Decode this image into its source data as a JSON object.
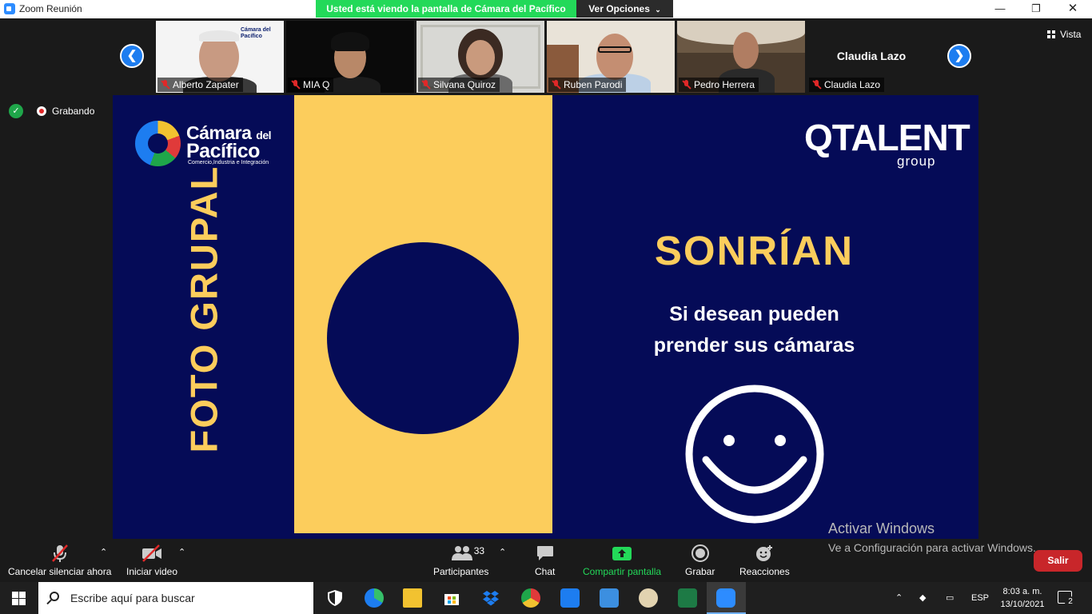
{
  "window": {
    "title": "Zoom Reunión",
    "share_banner": "Usted está viendo la pantalla de Cámara del Pacífico",
    "view_options": "Ver Opciones"
  },
  "participants": [
    {
      "name": "Alberto Zapater"
    },
    {
      "name": "MIA Q"
    },
    {
      "name": "Silvana Quiroz"
    },
    {
      "name": "Ruben Parodi"
    },
    {
      "name": "Pedro Herrera"
    },
    {
      "name": "Claudia Lazo",
      "display_name": "Claudia Lazo"
    }
  ],
  "thumb_logo_text": "Cámara del Pacífico",
  "view_button": "Vista",
  "recording": {
    "label": "Grabando"
  },
  "slide": {
    "side_title": "FOTO GRUPAL",
    "logo_line1": "Cámara",
    "logo_line1_small": "del",
    "logo_line2": "Pacífico",
    "logo_tagline": "Comercio,Industria e Integración",
    "brand": "QTALENT",
    "brand_sub": "group",
    "headline": "SONRÍAN",
    "line1": "Si desean pueden",
    "line2": "prender sus cámaras"
  },
  "watermark": {
    "line1": "Activar Windows",
    "line2": "Ve a Configuración para activar Windows."
  },
  "toolbar": {
    "mute": "Cancelar silenciar ahora",
    "video": "Iniciar video",
    "participants_count": "33",
    "participants": "Participantes",
    "chat": "Chat",
    "share": "Compartir pantalla",
    "record": "Grabar",
    "reactions": "Reacciones",
    "leave": "Salir"
  },
  "taskbar": {
    "search_placeholder": "Escribe aquí para buscar",
    "language": "ESP",
    "time": "8:03 a. m.",
    "date": "13/10/2021",
    "notifications": "2"
  },
  "colors": {
    "slide_bg": "#050b57",
    "slide_yellow": "#fccd5c",
    "zoom_green": "#23d959",
    "zoom_blue": "#1d7df0",
    "leave_red": "#c8262a"
  }
}
